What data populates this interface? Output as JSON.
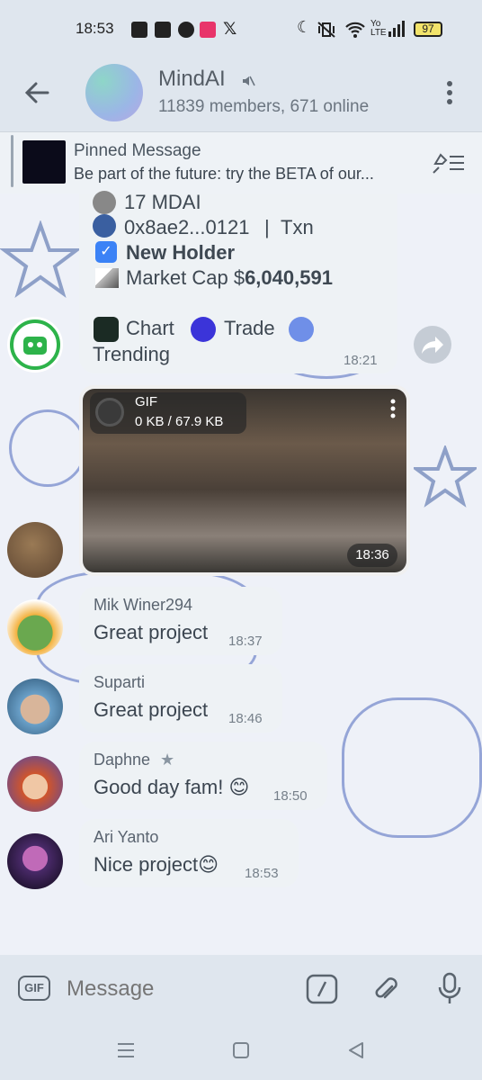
{
  "status": {
    "time": "18:53",
    "battery": "97",
    "network": "Yo LTE"
  },
  "header": {
    "title": "MindAI",
    "subtitle": "11839 members, 671 online"
  },
  "pinned": {
    "title": "Pinned Message",
    "text": "Be part of the future: try the BETA of our..."
  },
  "bot_card": {
    "amount": "17 MDAI",
    "address": "0x8ae2...0121",
    "separator": "|",
    "txn": "Txn",
    "new_holder": "New Holder",
    "market_cap_label": "Market Cap $",
    "market_cap_value": "6,040,591",
    "chart": "Chart",
    "trade": "Trade",
    "trending": "Trending",
    "time": "18:21"
  },
  "gif_message": {
    "label": "GIF",
    "size": "0 KB / 67.9 KB",
    "time": "18:36"
  },
  "messages": [
    {
      "name": "Mik Winer294",
      "text": "Great project",
      "time": "18:37"
    },
    {
      "name": "Suparti",
      "text": "Great project",
      "time": "18:46"
    },
    {
      "name": "Daphne",
      "text": "Good day fam! 😊",
      "time": "18:50"
    },
    {
      "name": "Ari Yanto",
      "text": "Nice project😊",
      "time": "18:53"
    }
  ],
  "input": {
    "placeholder": "Message",
    "gif_label": "GIF"
  },
  "colors": {
    "accent": "#3b82f6",
    "header_bg": "#dfe6ee",
    "bubble_bg": "#eef2f5"
  }
}
